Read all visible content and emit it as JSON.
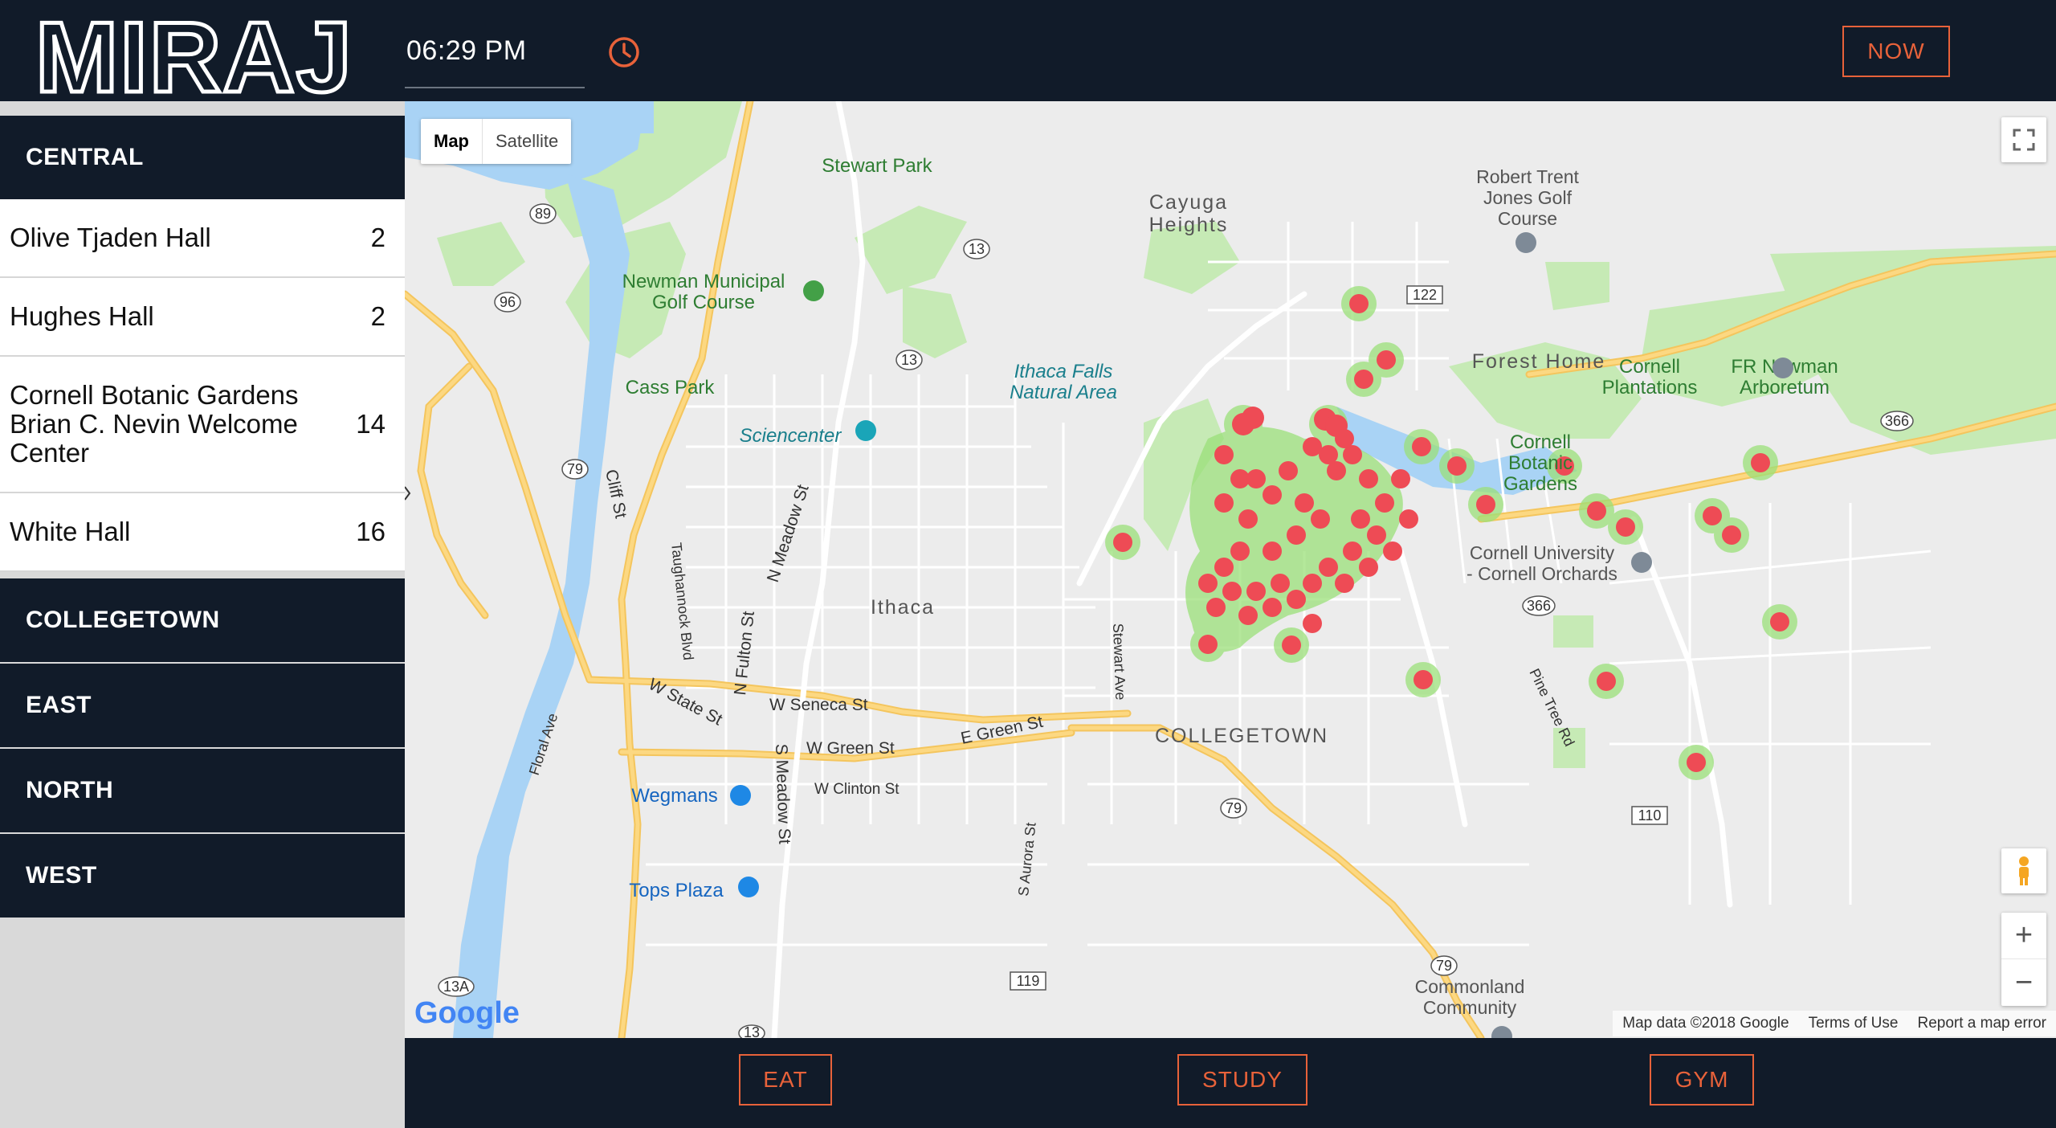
{
  "header": {
    "logo_text": "MIRAJ",
    "time": "06:29 PM",
    "now_label": "NOW"
  },
  "sidebar": {
    "regions": [
      {
        "label": "CENTRAL",
        "expanded": true
      },
      {
        "label": "COLLEGETOWN",
        "expanded": false
      },
      {
        "label": "EAST",
        "expanded": false
      },
      {
        "label": "NORTH",
        "expanded": false
      },
      {
        "label": "WEST",
        "expanded": false
      }
    ],
    "locations": [
      {
        "name": "Olive Tjaden Hall",
        "count": "2"
      },
      {
        "name": "Hughes Hall",
        "count": "2"
      },
      {
        "name": "Cornell Botanic Gardens Brian C. Nevin Welcome Center",
        "count": "14"
      },
      {
        "name": "White Hall",
        "count": "16"
      }
    ]
  },
  "map": {
    "type_map": "Map",
    "type_satellite": "Satellite",
    "labels": {
      "stewart_park": "Stewart Park",
      "cayuga_heights_1": "Cayuga",
      "cayuga_heights_2": "Heights",
      "robert_trent_1": "Robert Trent",
      "robert_trent_2": "Jones Golf",
      "robert_trent_3": "Course",
      "newman_golf_1": "Newman Municipal",
      "newman_golf_2": "Golf Course",
      "fr_newman_1": "FR Newman",
      "fr_newman_2": "Arboretum",
      "forest_home": "Forest Home",
      "cornell_plantations_1": "Cornell",
      "cornell_plantations_2": "Plantations",
      "ithaca_falls_1": "Ithaca Falls",
      "ithaca_falls_2": "Natural Area",
      "cass_park": "Cass Park",
      "sciencenter": "Sciencenter",
      "cornell_botanic_1": "Cornell",
      "cornell_botanic_2": "Botanic",
      "cornell_botanic_3": "Gardens",
      "cornell_orchards_1": "Cornell University",
      "cornell_orchards_2": "- Cornell Orchards",
      "ithaca": "Ithaca",
      "collegetown": "COLLEGETOWN",
      "w_seneca": "W Seneca St",
      "w_green": "W Green St",
      "e_green": "E Green St",
      "w_clinton": "W Clinton St",
      "wegmans": "Wegmans",
      "tops_plaza": "Tops Plaza",
      "commonland_1": "Commonland",
      "commonland_2": "Community",
      "cliff_st": "Cliff St",
      "taughannock": "Taughannock Blvd",
      "floral_ave": "Floral Ave",
      "w_state": "W State St",
      "n_fulton": "N Fulton St",
      "n_meadow": "N Meadow St",
      "s_meadow": "S Meadow St",
      "stewart_ave": "Stewart Ave",
      "s_aurora": "S Aurora St",
      "pine_tree": "Pine Tree Rd",
      "r89": "89",
      "r96": "96",
      "r79a": "79",
      "r13a": "13",
      "r13b": "13",
      "r122": "122",
      "r366a": "366",
      "r366b": "366",
      "r79b": "79",
      "r79c": "79",
      "r110": "110",
      "r119": "119",
      "r13c": "13A",
      "r13d": "13"
    },
    "google_logo": "Google",
    "attribution": {
      "data": "Map data ©2018 Google",
      "terms": "Terms of Use",
      "report": "Report a map error"
    },
    "heat_color": "#ee4b55",
    "heat_glow": "#9be07a"
  },
  "footer": {
    "eat": "EAT",
    "study": "STUDY",
    "gym": "GYM"
  },
  "colors": {
    "navy": "#111b29",
    "accent": "#e8623a",
    "water": "#a9d3f5",
    "park": "#c6eab5",
    "road": "#fcd882"
  }
}
